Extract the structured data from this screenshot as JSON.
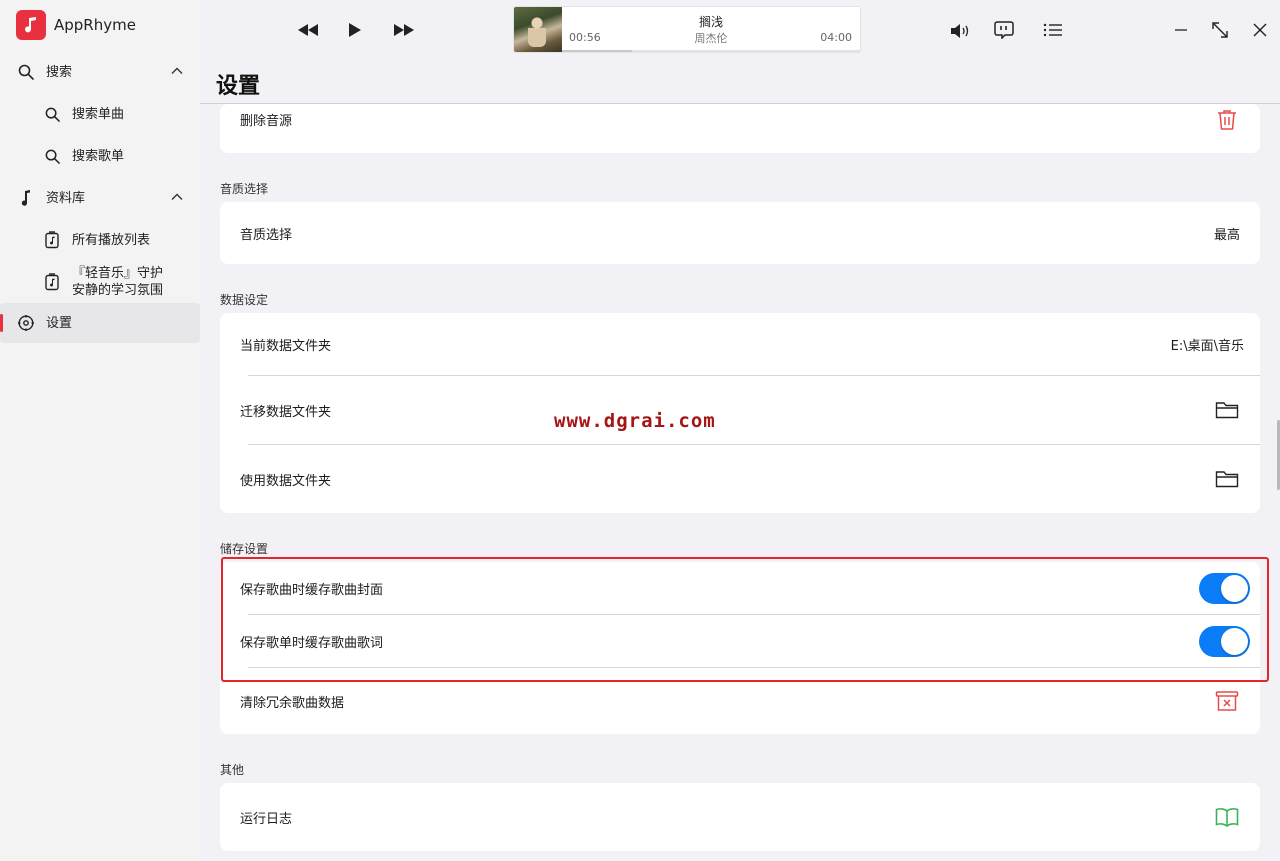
{
  "app": {
    "name": "AppRhyme"
  },
  "sidebar": {
    "items": [
      {
        "label": "搜索"
      },
      {
        "label": "搜索单曲"
      },
      {
        "label": "搜索歌单"
      },
      {
        "label": "资料库"
      },
      {
        "label": "所有播放列表"
      },
      {
        "label_line1": "『轻音乐』守护",
        "label_line2": "安静的学习氛围"
      },
      {
        "label": "设置"
      }
    ]
  },
  "player": {
    "title": "搁浅",
    "artist": "周杰伦",
    "current_time": "00:56",
    "total_time": "04:00",
    "progress": 0.233
  },
  "page": {
    "title": "设置",
    "sections": {
      "source": {
        "delete_label": "删除音源"
      },
      "quality": {
        "header": "音质选择",
        "row_label": "音质选择",
        "row_value": "最高"
      },
      "data": {
        "header": "数据设定",
        "current_folder_label": "当前数据文件夹",
        "current_folder_value": "E:\\桌面\\音乐",
        "migrate_label": "迁移数据文件夹",
        "use_label": "使用数据文件夹"
      },
      "storage": {
        "header": "储存设置",
        "cache_cover_label": "保存歌曲时缓存歌曲封面",
        "cache_cover_on": true,
        "cache_lyrics_label": "保存歌单时缓存歌曲歌词",
        "cache_lyrics_on": true,
        "clear_label": "清除冗余歌曲数据"
      },
      "other": {
        "header": "其他",
        "log_label": "运行日志"
      }
    }
  },
  "watermark": "www.dgrai.com",
  "colors": {
    "accent": "#e8303e",
    "toggle_on": "#0a7cf7",
    "danger_icon": "#e84a4a",
    "log_icon": "#3cb35b",
    "highlight": "#e3262b"
  }
}
